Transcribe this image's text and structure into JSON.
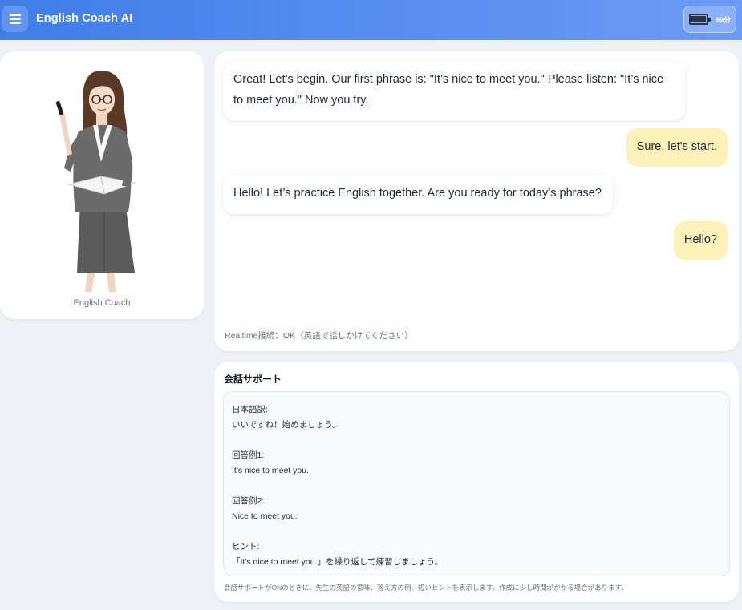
{
  "header": {
    "title": "English Coach AI",
    "menu_icon": "hamburger-menu-icon",
    "battery": {
      "icon": "battery-icon",
      "text": "99分",
      "level_percent": 0.99
    }
  },
  "coach": {
    "caption": "English Coach",
    "image": "teacher-illustration"
  },
  "chat": {
    "messages": [
      {
        "role": "coach",
        "text": "Great! Let’s begin. Our first phrase is: \"It’s nice to meet you.\" Please listen: \"It’s nice to meet you.\" Now you try."
      },
      {
        "role": "user",
        "text": "Sure, let's start."
      },
      {
        "role": "coach",
        "text": "Hello! Let’s practice English together. Are you ready for today’s phrase?"
      },
      {
        "role": "user",
        "text": "Hello?"
      }
    ],
    "status": "Realtime接続：OK（英語で話しかけてください）"
  },
  "support": {
    "title": "会話サポート",
    "blocks": [
      {
        "label": "日本語訳:",
        "text": "いいですね！始めましょう。"
      },
      {
        "label": "回答例1:",
        "text": "It's nice to meet you."
      },
      {
        "label": "回答例2:",
        "text": "Nice to meet you."
      },
      {
        "label": "ヒント:",
        "text": "「It's nice to meet you.」を繰り返して練習しましょう。"
      }
    ],
    "note": "会話サポートがONのときに、先生の英語の意味、答え方の例、短いヒントを表示します。作成に少し時間がかかる場合があります。"
  },
  "colors": {
    "header_start": "#3f7ee8",
    "header_end": "#6b9bf4",
    "user_bubble": "#fdf0b8",
    "page_bg": "#eef1f6"
  }
}
